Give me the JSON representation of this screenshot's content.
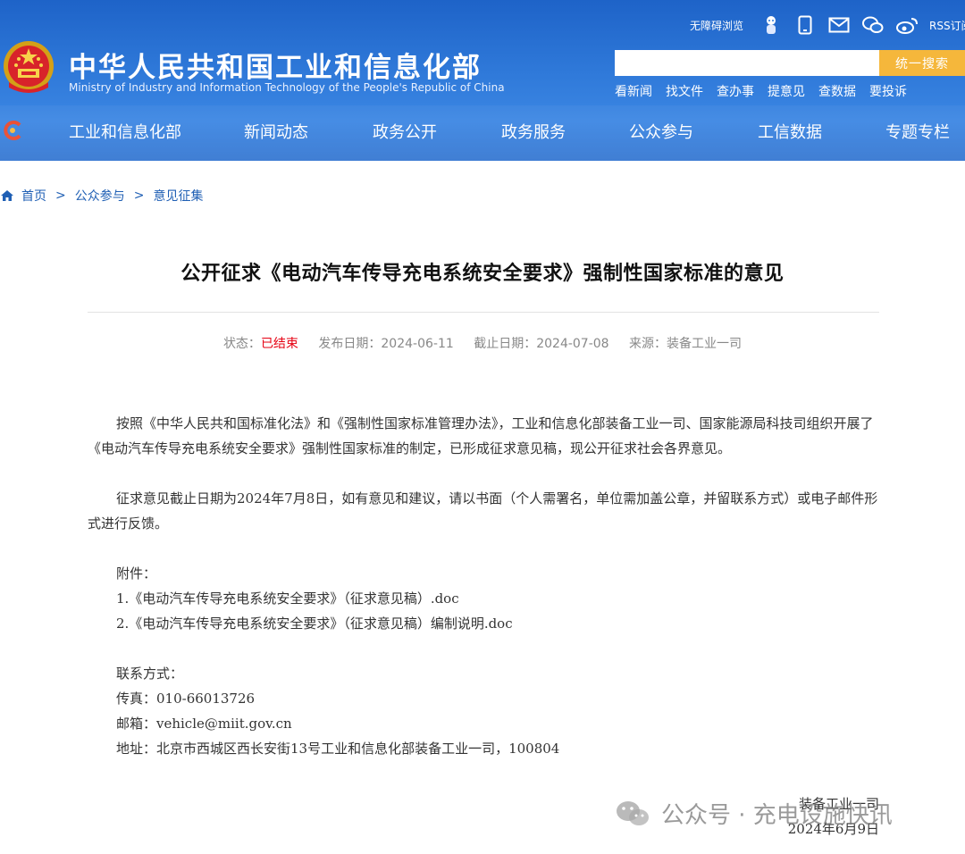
{
  "header": {
    "site_title": "中华人民共和国工业和信息化部",
    "site_subtitle": "Ministry of Industry and Information Technology of the People's Republic of China",
    "accessibility": "无障碍浏览",
    "rss": "RSS订阅",
    "search_placeholder": "",
    "search_button": "统一搜索",
    "quick_links": [
      "看新闻",
      "找文件",
      "查办事",
      "提意见",
      "查数据",
      "要投诉"
    ],
    "nav": [
      "工业和信息化部",
      "新闻动态",
      "政务公开",
      "政务服务",
      "公众参与",
      "工信数据",
      "专题专栏"
    ]
  },
  "breadcrumb": [
    "首页",
    "公众参与",
    "意见征集"
  ],
  "article": {
    "title": "公开征求《电动汽车传导充电系统安全要求》强制性国家标准的意见",
    "meta": {
      "status_label": "状态：",
      "status_value": "已结束",
      "publish_label": "发布日期：",
      "publish_date": "2024-06-11",
      "deadline_label": "截止日期：",
      "deadline_date": "2024-07-08",
      "source_label": "来源：",
      "source_value": "装备工业一司"
    },
    "para1": "按照《中华人民共和国标准化法》和《强制性国家标准管理办法》，工业和信息化部装备工业一司、国家能源局科技司组织开展了《电动汽车传导充电系统安全要求》强制性国家标准的制定，已形成征求意见稿，现公开征求社会各界意见。",
    "para2": "征求意见截止日期为2024年7月8日，如有意见和建议，请以书面（个人需署名，单位需加盖公章，并留联系方式）或电子邮件形式进行反馈。",
    "attachments_label": "附件：",
    "attachments": [
      "1.《电动汽车传导充电系统安全要求》（征求意见稿）.doc",
      "2.《电动汽车传导充电系统安全要求》（征求意见稿）编制说明.doc"
    ],
    "contact_label": "联系方式：",
    "fax": "传真：010-66013726",
    "email": "邮箱：vehicle@miit.gov.cn",
    "address": "地址：北京市西城区西长安街13号工业和信息化部装备工业一司，100804",
    "sign_org": "装备工业一司",
    "sign_date": "2024年6月9日"
  },
  "watermark": "公众号 · 充电设施快讯",
  "colors": {
    "header_blue": "#2f79d9",
    "search_orange": "#f5b73b",
    "link_blue": "#1f5fb4",
    "status_red": "#e60012"
  }
}
